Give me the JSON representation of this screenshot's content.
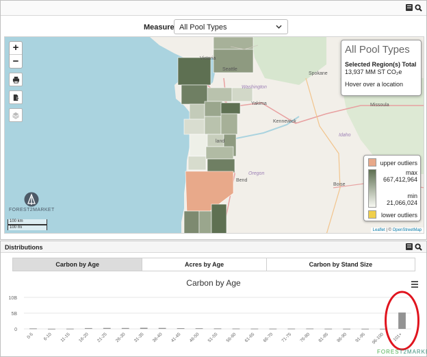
{
  "measure": {
    "label": "Measure",
    "selected": "All Pool Types"
  },
  "info_box": {
    "title": "All Pool Types",
    "selected_label": "Selected Region(s) Total",
    "selected_value": "13,937 MM ST CO₂e",
    "hover_text": "Hover over a location"
  },
  "legend": {
    "upper": "upper outliers",
    "max_label": "max",
    "max_value": "667,412,964",
    "min_label": "min",
    "min_value": "21,066,024",
    "lower": "lower outliers",
    "colors": {
      "upper": "#e8a98a",
      "ramp_dark": "#5e7052",
      "ramp_light": "#f7f8f2",
      "lower": "#f0cf4c"
    }
  },
  "map": {
    "labels": {
      "victoria": "Victoria",
      "seattle": "Seattle",
      "washington": "Washington",
      "spokane": "Spokane",
      "yakima": "Yakima",
      "kennewick": "Kennewick",
      "missoula": "Missoula",
      "portland": "land",
      "oregon": "Oregon",
      "bend": "Bend",
      "idaho": "Idaho",
      "boise": "Boise"
    },
    "brand": "FOREST2MARKET",
    "scale_km": "100 km",
    "scale_mi": "100 mi",
    "attribution_leaflet": "Leaflet",
    "attribution_sep": " | © ",
    "attribution_osm": "OpenStreetMap"
  },
  "distributions": {
    "title": "Distributions",
    "tabs": [
      {
        "label": "Carbon by Age",
        "active": true
      },
      {
        "label": "Acres by Age",
        "active": false
      },
      {
        "label": "Carbon by Stand Size",
        "active": false
      }
    ],
    "footer_brand_a": "FORES",
    "footer_brand_b": "T2MARKET"
  },
  "chart_data": {
    "type": "bar",
    "title": "Carbon by Age",
    "xlabel": "",
    "ylabel": "",
    "ylim": [
      0,
      10
    ],
    "y_ticks": [
      "10B",
      "5B",
      "0"
    ],
    "categories": [
      "0-5",
      "6-10",
      "11-15",
      "16-20",
      "21-25",
      "26-30",
      "31-35",
      "36-40",
      "41-45",
      "46-50",
      "51-55",
      "56-60",
      "61-65",
      "66-70",
      "71-75",
      "76-80",
      "81-85",
      "86-90",
      "91-95",
      "96-100",
      "101+"
    ],
    "values": [
      0.15,
      0.05,
      0.08,
      0.25,
      0.3,
      0.28,
      0.35,
      0.3,
      0.22,
      0.2,
      0.15,
      0.12,
      0.1,
      0.09,
      0.1,
      0.12,
      0.08,
      0.07,
      0.06,
      0.05,
      5.2
    ],
    "bar_color": "#939393",
    "highlight_index": 20,
    "highlight_color": "#e0141e"
  }
}
